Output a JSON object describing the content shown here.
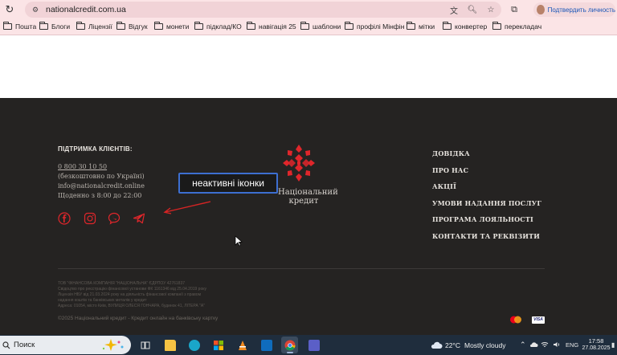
{
  "browser": {
    "url": "nationalcredit.com.ua",
    "profile_label": "Подтвердить личность",
    "bookmarks": [
      "Пошта",
      "Блоги",
      "Ліцензії",
      "Відгук",
      "монети",
      "підклад/КО",
      "навігація 25",
      "шаблони",
      "профілі Мінфін",
      "мітки",
      "конвертер",
      "перекладач"
    ]
  },
  "footer": {
    "support": {
      "title": "ПІДТРИМКА КЛІЄНТІВ:",
      "phone": "0 800 30 10 50",
      "phone_note": "(безкоштовно по Україні)",
      "email": "info@nationalcredit.online",
      "hours": "Щоденно з 8:00 до 22:00"
    },
    "social_icons": [
      "facebook-icon",
      "instagram-icon",
      "viber-icon",
      "telegram-icon"
    ],
    "annotation": "неактивні іконки",
    "logo": {
      "line1": "Національний",
      "line2": "кредит"
    },
    "menu": [
      "ДОВІДКА",
      "ПРО НАС",
      "АКЦІЇ",
      "УМОВИ НАДАННЯ ПОСЛУГ",
      "ПРОГРАМА ЛОЯЛЬНОСТІ",
      "КОНТАКТИ ТА РЕКВІЗИТИ"
    ],
    "legal": [
      "ТОВ \"ФІНАНСОВА КОМПАНІЯ \"НАЦІОНАЛЬНА\" ЄДРПОУ 42761837",
      "Свідоцтво про реєстрацію фінансової установи ФК 1161346 від 25.04.2019 року",
      "Ліцензія НБУ від 21.03.2024 року на діяльність фінансової компанії з правом",
      "надання коштів та банківських металів у кредит",
      "Адреса: 01054, місто Київ, ВУЛИЦЯ ОЛЕСЯ ГОНЧАРА, будинок 41, ЛІТЕРА \"А\""
    ],
    "copyright": "©2025 Національний кредит - Кредит онлайн на банківську картку",
    "payments": [
      "mastercard-logo",
      "visa-logo"
    ],
    "visa_text": "VISA"
  },
  "taskbar": {
    "search_placeholder": "Поиск",
    "apps": [
      "task-view",
      "file-explorer",
      "edge",
      "microsoft-store",
      "vlc",
      "outlook",
      "chrome",
      "teams"
    ],
    "weather_temp": "22°C",
    "weather_desc": "Mostly cloudy",
    "lang": "ENG",
    "time": "17:58",
    "date": "27.08.2025"
  },
  "colors": {
    "browser_bg": "#fbe4e6",
    "footer_bg": "#252322",
    "accent_red": "#e0262b",
    "callout_border": "#3d6fd1",
    "taskbar_bg": "#1f2d3d"
  }
}
